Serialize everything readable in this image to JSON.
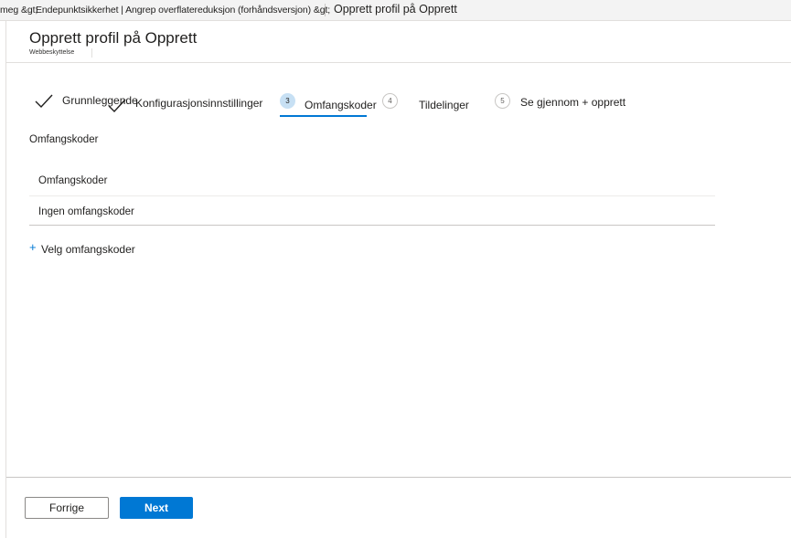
{
  "breadcrumb": {
    "part1": "meg &gt;",
    "part2": "Endepunktsikkerhet | Angrep overflatereduksjon (forhåndsversjon) &gt;",
    "current": "Opprett profil på Opprett"
  },
  "header": {
    "title": "Opprett profil på Opprett",
    "subtitle": "Webbeskyttelse"
  },
  "wizard": {
    "steps": [
      {
        "label": "Grunnleggende",
        "state": "completed"
      },
      {
        "label": "Konfigurasjonsinnstillinger",
        "state": "completed"
      },
      {
        "number": "3",
        "label": "Omfangskoder",
        "state": "active"
      },
      {
        "number": "4",
        "label": "Tildelinger",
        "state": "pending"
      },
      {
        "number": "5",
        "label": "Se gjennom + opprett",
        "state": "pending"
      }
    ]
  },
  "scope": {
    "section_label": "Omfangskoder",
    "column_header": "Omfangskoder",
    "empty_text": "Ingen omfangskoder",
    "add_label": "Velg omfangskoder"
  },
  "footer": {
    "prev_label": "Forrige",
    "next_label": "Next"
  },
  "colors": {
    "accent": "#0078d4",
    "active_step_bg": "#c7e0f4"
  },
  "icons": {
    "completed_step": "checkmark-icon",
    "add": "plus-icon"
  }
}
